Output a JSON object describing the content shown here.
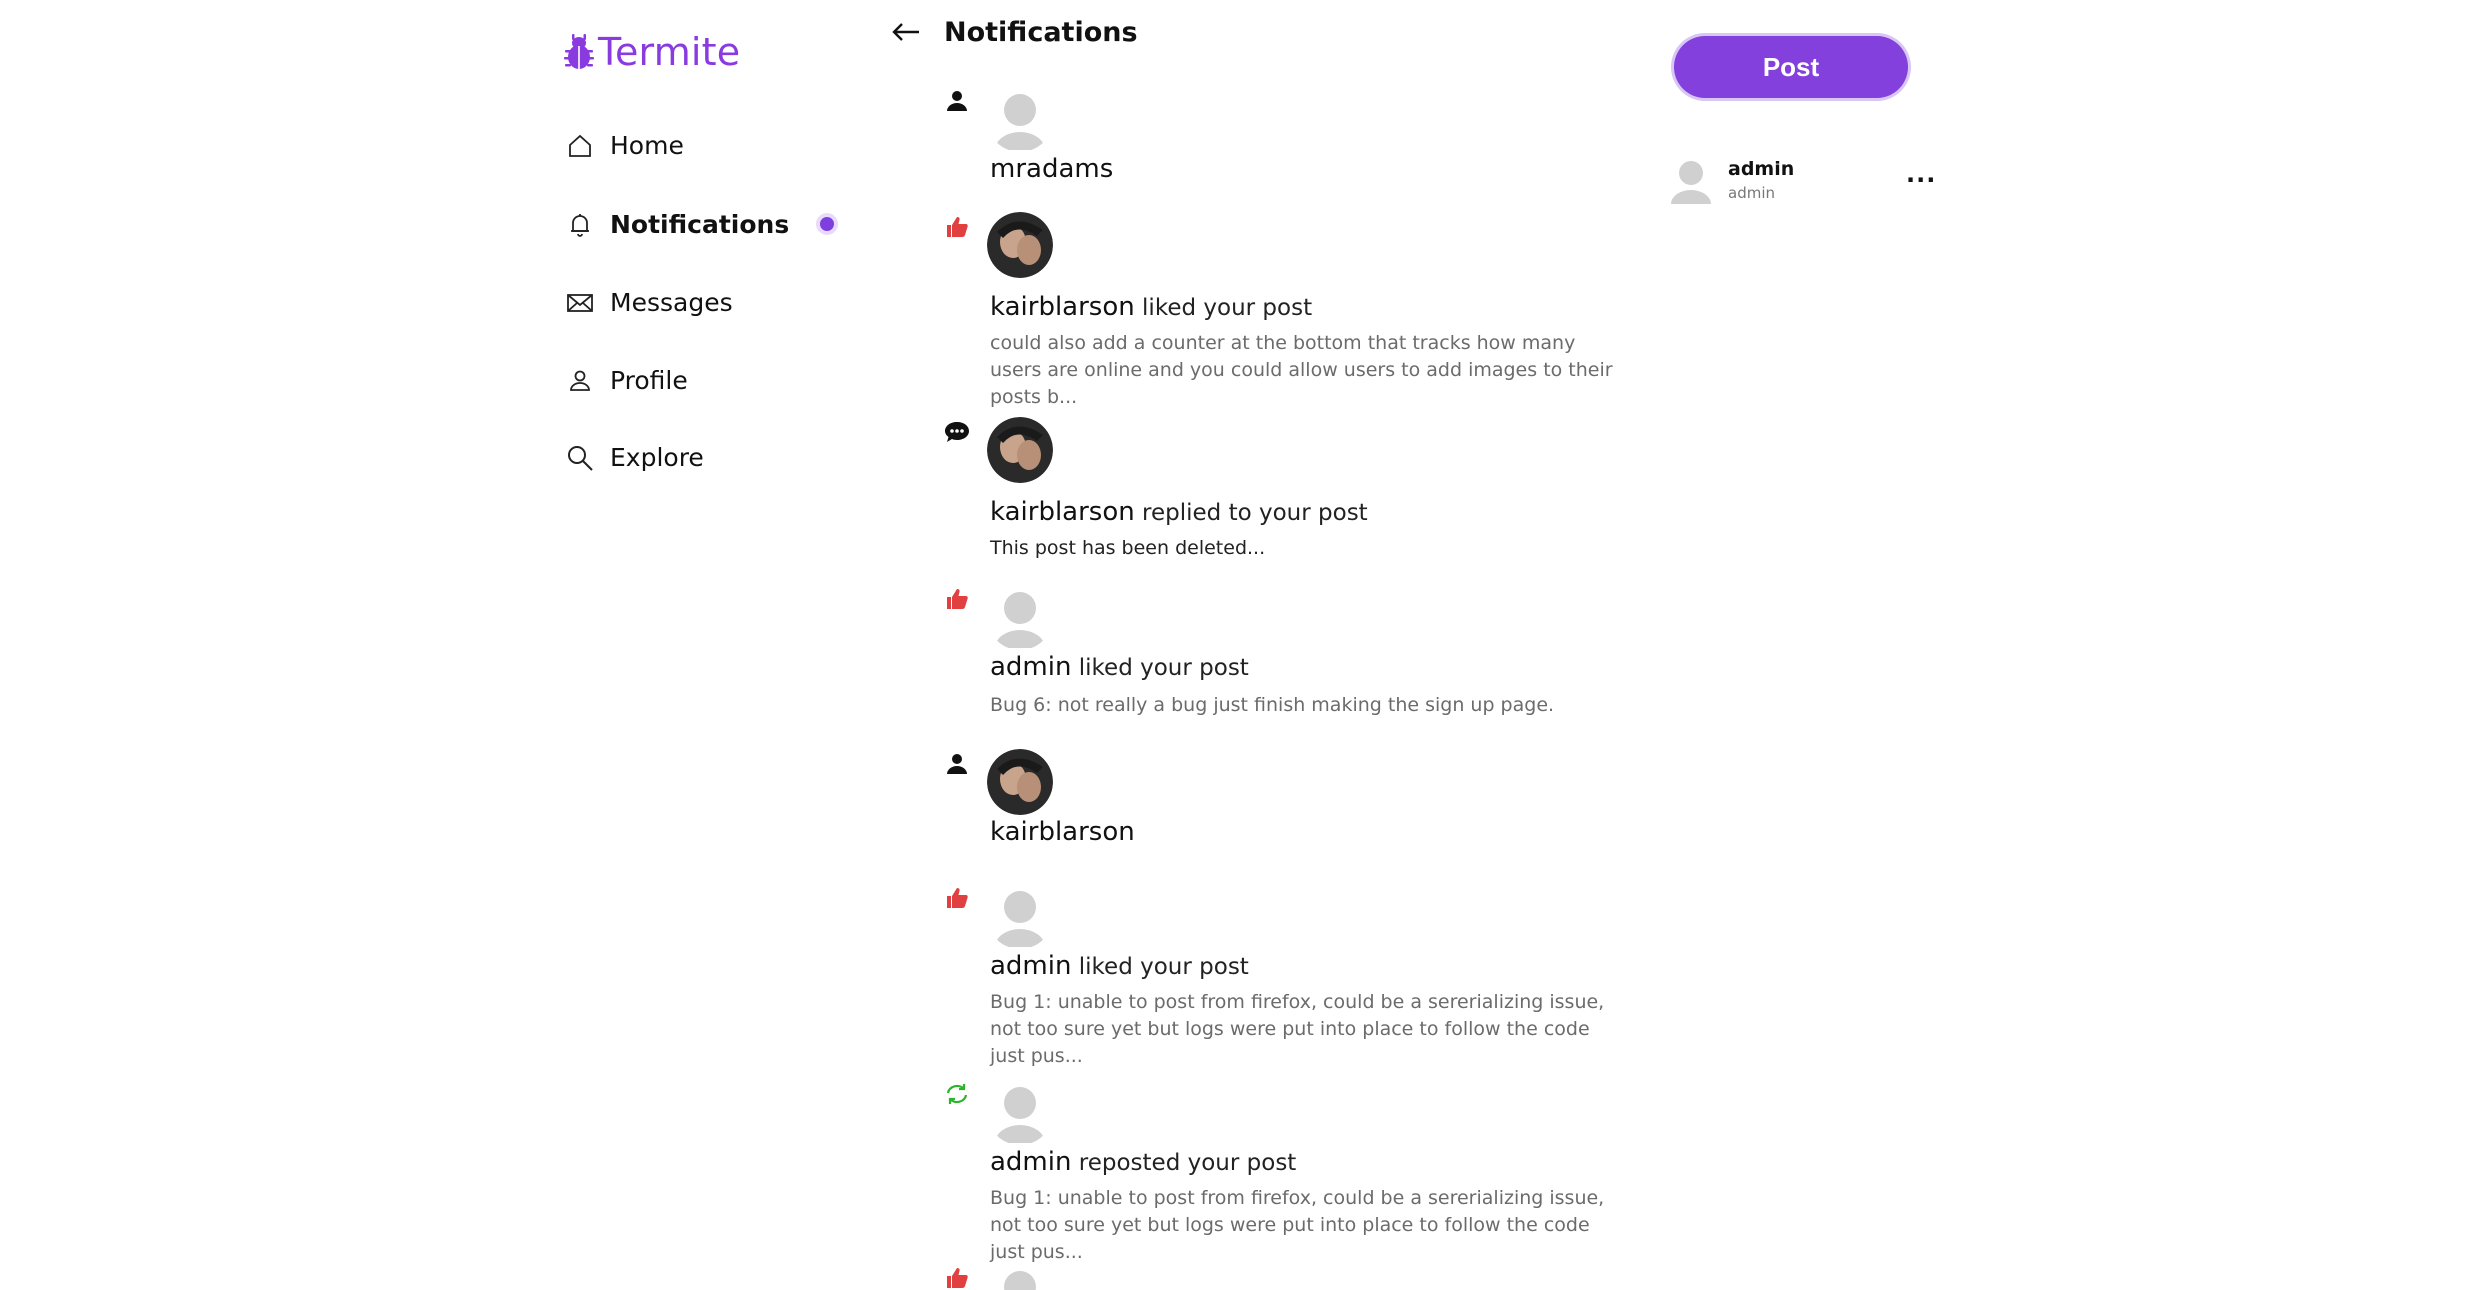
{
  "app": {
    "name": "Termite",
    "accent": "#8340dd"
  },
  "sidebar": {
    "items": [
      {
        "label": "Home",
        "icon": "home-icon"
      },
      {
        "label": "Notifications",
        "icon": "bell-icon",
        "active": true,
        "unread_dot": true
      },
      {
        "label": "Messages",
        "icon": "envelope-icon"
      },
      {
        "label": "Profile",
        "icon": "person-icon"
      },
      {
        "label": "Explore",
        "icon": "search-icon"
      }
    ]
  },
  "header": {
    "title": "Notifications",
    "back_icon": "arrow-left-icon"
  },
  "notifications": [
    {
      "type": "follow",
      "icon": "person-icon",
      "user": "mradams",
      "action": "",
      "avatar": "default",
      "preview": ""
    },
    {
      "type": "like",
      "icon": "thumbs-up-icon",
      "user": "kairblarson",
      "action": "liked your post",
      "avatar": "photo",
      "preview": "could also add a counter at the bottom that tracks how many users are online and you could allow users to add images to their posts b..."
    },
    {
      "type": "reply",
      "icon": "speech-bubble-icon",
      "user": "kairblarson",
      "action": "replied to your post",
      "avatar": "photo",
      "preview": "This post has been deleted..."
    },
    {
      "type": "like",
      "icon": "thumbs-up-icon",
      "user": "admin",
      "action": "liked your post",
      "avatar": "default",
      "preview": "Bug 6: not really a bug just finish making the sign up page."
    },
    {
      "type": "follow",
      "icon": "person-icon",
      "user": "kairblarson",
      "action": "",
      "avatar": "photo",
      "preview": ""
    },
    {
      "type": "like",
      "icon": "thumbs-up-icon",
      "user": "admin",
      "action": "liked your post",
      "avatar": "default",
      "preview": "Bug 1: unable to post from firefox, could be a sererializing issue, not too sure yet but logs were put into place to follow the code just pus..."
    },
    {
      "type": "repost",
      "icon": "repost-icon",
      "user": "admin",
      "action": "reposted your post",
      "avatar": "default",
      "preview": "Bug 1: unable to post from firefox, could be a sererializing issue, not too sure yet but logs were put into place to follow the code just pus..."
    },
    {
      "type": "like",
      "icon": "thumbs-up-icon",
      "user": "",
      "action": "",
      "avatar": "default",
      "preview": ""
    }
  ],
  "right": {
    "post_button": "Post",
    "account": {
      "name": "admin",
      "handle": "admin",
      "more": "..."
    }
  }
}
